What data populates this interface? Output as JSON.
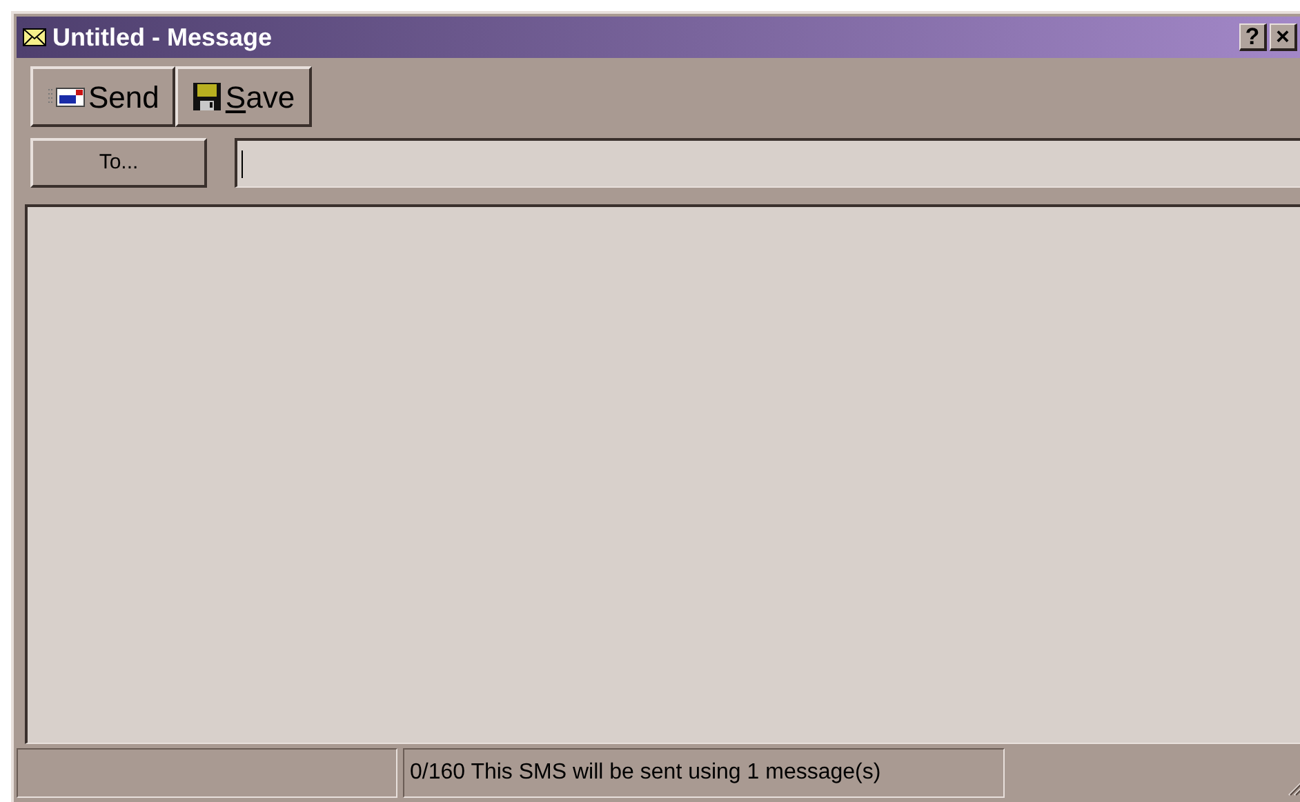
{
  "window": {
    "title": "Untitled - Message",
    "title_buttons": [
      "?",
      "×"
    ]
  },
  "toolbar": [
    {
      "label": "Send",
      "kind": "send",
      "underline_first": false
    },
    {
      "label": "Save",
      "kind": "save",
      "underline_first": true
    }
  ],
  "to_button": {
    "label": "To..."
  },
  "status_bar": {
    "text": "0/160  This SMS will be sent using 1 message(s)"
  }
}
